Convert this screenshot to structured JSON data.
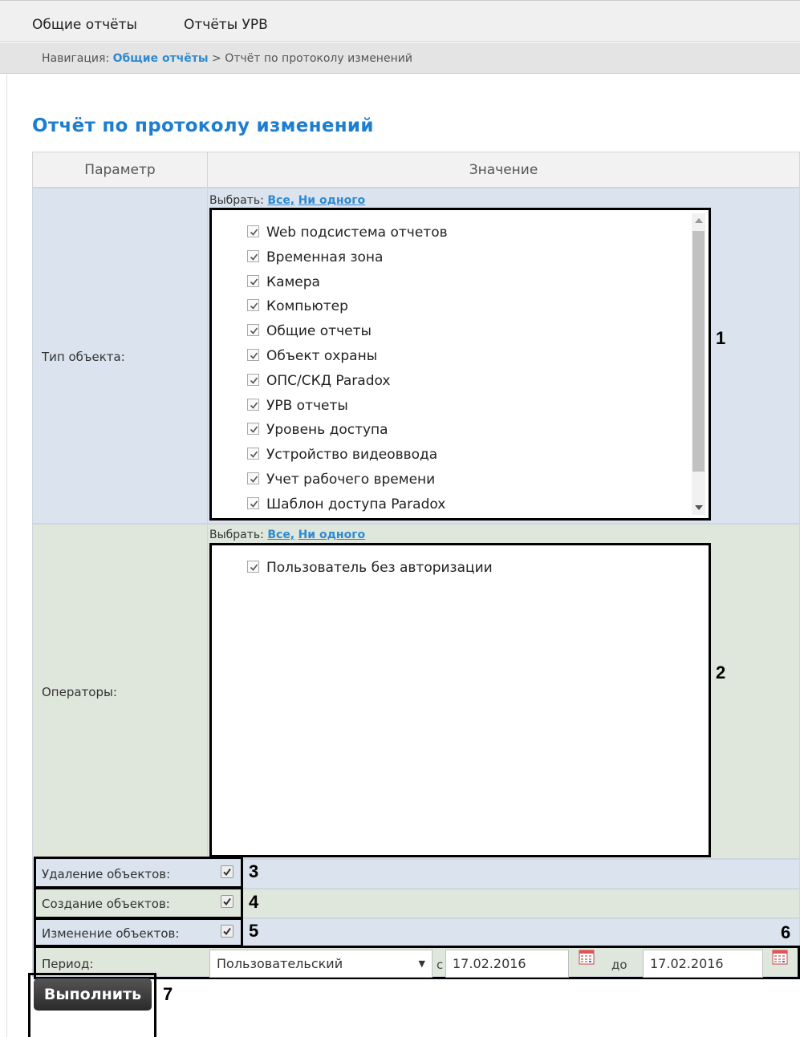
{
  "menu": {
    "items": [
      "Общие отчёты",
      "Отчёты УРВ"
    ]
  },
  "breadcrumb": {
    "prefix": "Навигация:",
    "link": "Общие отчёты",
    "separator": ">",
    "current": "Отчёт по протоколу изменений"
  },
  "page_title": "Отчёт по протоколу изменений",
  "table": {
    "col_param": "Параметр",
    "col_value": "Значение"
  },
  "object_types": {
    "label": "Тип объекта:",
    "select": {
      "prefix": "Выбрать:",
      "all": "Все,",
      "none": "Ни одного"
    },
    "items": [
      {
        "label": "Web подсистема отчетов",
        "checked": true
      },
      {
        "label": "Временная зона",
        "checked": true
      },
      {
        "label": "Камера",
        "checked": true
      },
      {
        "label": "Компьютер",
        "checked": true
      },
      {
        "label": "Общие отчеты",
        "checked": true
      },
      {
        "label": "Объект охраны",
        "checked": true
      },
      {
        "label": "ОПС/СКД Paradox",
        "checked": true
      },
      {
        "label": "УРВ отчеты",
        "checked": true
      },
      {
        "label": "Уровень доступа",
        "checked": true
      },
      {
        "label": "Устройство видеоввода",
        "checked": true
      },
      {
        "label": "Учет рабочего времени",
        "checked": true
      },
      {
        "label": "Шаблон доступа Paradox",
        "checked": true
      }
    ]
  },
  "operators": {
    "label": "Операторы:",
    "select": {
      "prefix": "Выбрать:",
      "all": "Все,",
      "none": "Ни одного"
    },
    "items": [
      {
        "label": "Пользователь без авторизации",
        "checked": true
      }
    ]
  },
  "options": {
    "delete_label": "Удаление объектов:",
    "create_label": "Создание объектов:",
    "change_label": "Изменение объектов:",
    "delete_checked": true,
    "create_checked": true,
    "change_checked": true
  },
  "period": {
    "label": "Период:",
    "selected": "Пользовательский",
    "from_label": "с",
    "from": "17.02.2016",
    "to_label": "до",
    "to": "17.02.2016"
  },
  "run_button": "Выполнить",
  "annotations": [
    "1",
    "2",
    "3",
    "4",
    "5",
    "6",
    "7"
  ]
}
